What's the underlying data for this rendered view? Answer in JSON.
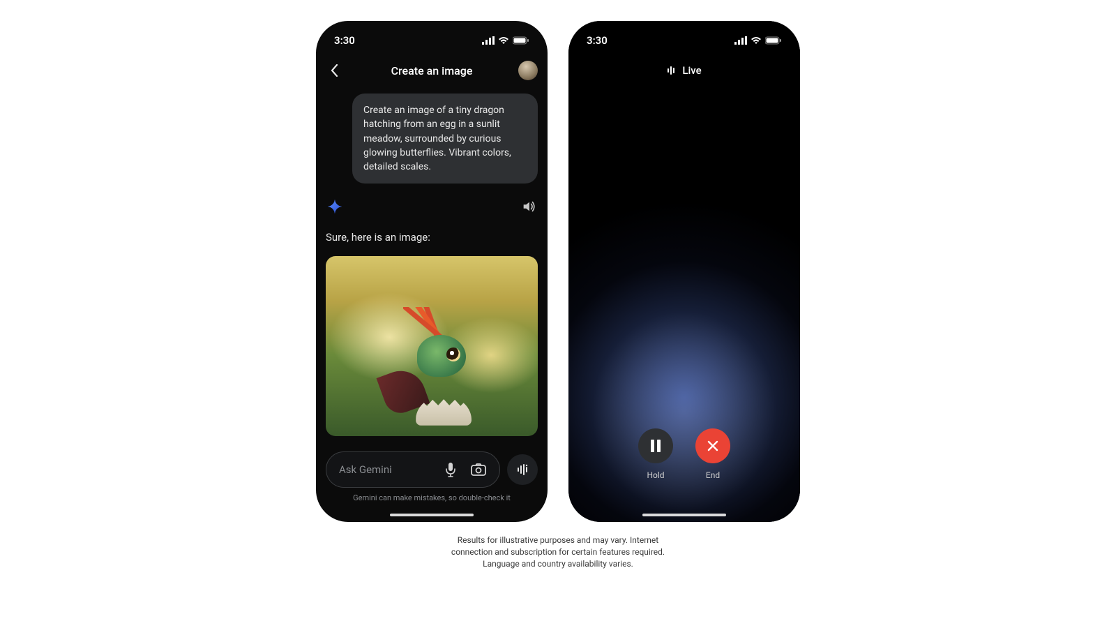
{
  "status": {
    "time": "3:30"
  },
  "phone1": {
    "header_title": "Create an image",
    "user_message": "Create an image of a tiny dragon hatching from an egg in a sunlit meadow, surrounded by curious glowing butterflies. Vibrant colors, detailed scales.",
    "assistant_reply": "Sure, here is an image:",
    "input_placeholder": "Ask Gemini",
    "footer_disclaimer": "Gemini can make mistakes, so double-check it"
  },
  "phone2": {
    "header_label": "Live",
    "hold_label": "Hold",
    "end_label": "End"
  },
  "caption_line1": "Results for illustrative purposes and may vary. Internet",
  "caption_line2": "connection and subscription for certain features required.",
  "caption_line3": "Language and country availability varies."
}
